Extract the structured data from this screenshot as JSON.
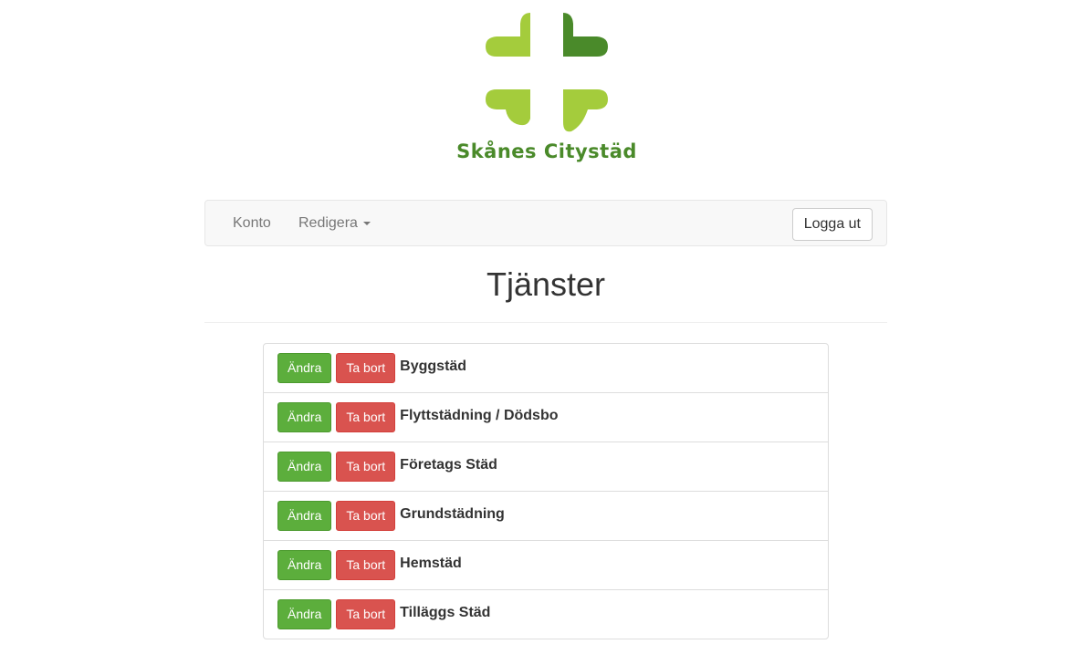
{
  "brand": {
    "name": "Skånes Citystäd",
    "colors": {
      "light_green": "#a4cc3c",
      "dark_green": "#4a8a2a"
    }
  },
  "navbar": {
    "items": [
      {
        "label": "Konto"
      },
      {
        "label": "Redigera",
        "has_dropdown": true
      }
    ],
    "logout_label": "Logga ut"
  },
  "page": {
    "title": "Tjänster"
  },
  "services": [
    {
      "name": "Byggstäd",
      "edit_label": "Ändra",
      "delete_label": "Ta bort"
    },
    {
      "name": "Flyttstädning / Dödsbo",
      "edit_label": "Ändra",
      "delete_label": "Ta bort"
    },
    {
      "name": "Företags Städ",
      "edit_label": "Ändra",
      "delete_label": "Ta bort"
    },
    {
      "name": "Grundstädning",
      "edit_label": "Ändra",
      "delete_label": "Ta bort"
    },
    {
      "name": "Hemstäd",
      "edit_label": "Ändra",
      "delete_label": "Ta bort"
    },
    {
      "name": "Tilläggs Städ",
      "edit_label": "Ändra",
      "delete_label": "Ta bort"
    }
  ],
  "colors": {
    "edit_button": "#5cae3c",
    "delete_button": "#d9534f",
    "navbar_bg": "#f8f8f8"
  }
}
